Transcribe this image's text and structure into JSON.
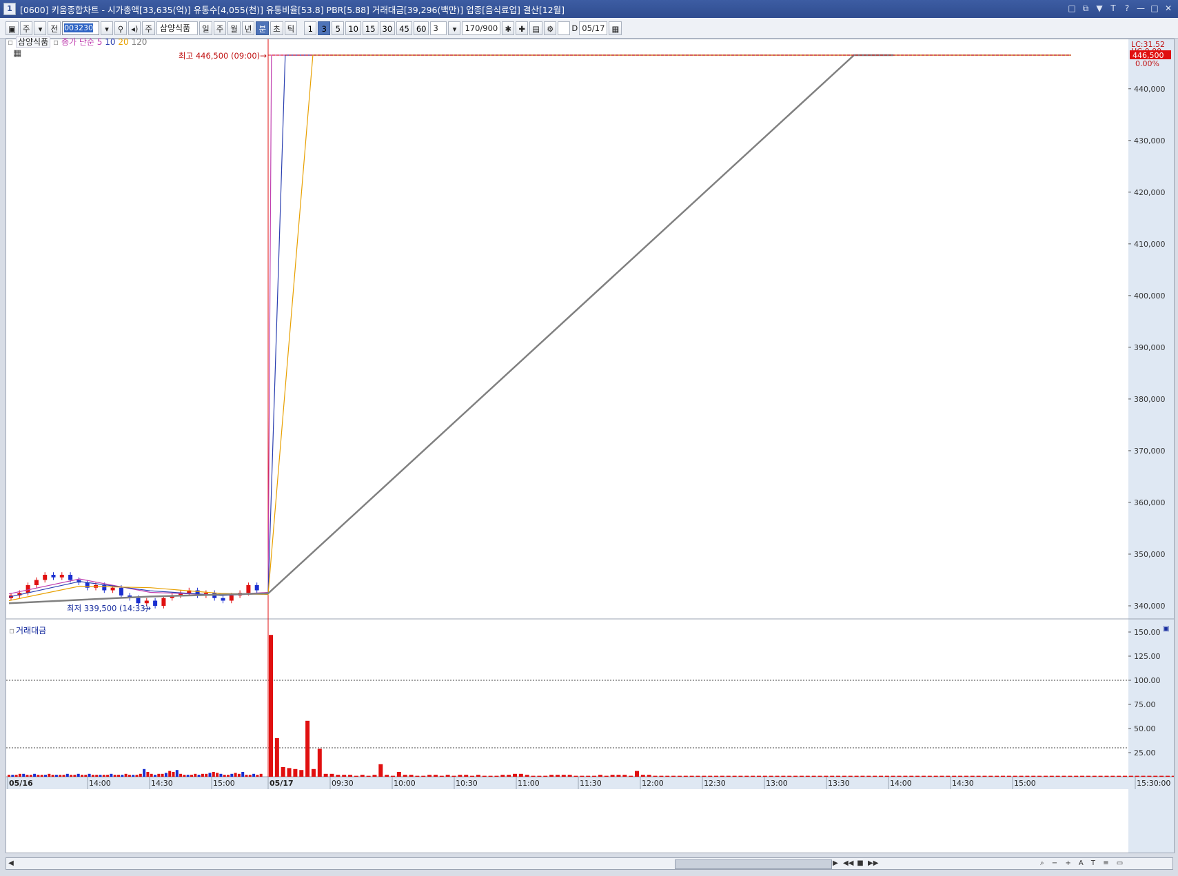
{
  "window": {
    "number": "1",
    "title": "[0600] 키움종합차트 - 시가총액[33,635(억)] 유통수[4,055(천)] 유통비율[53.8] PBR[5.88] 거래대금[39,296(백만)] 업종[음식료업] 결산[12월]",
    "buttons": [
      "□",
      "⧉",
      "▼",
      "T",
      "?",
      "—",
      "□",
      "✕"
    ]
  },
  "toolbar": {
    "market": "주",
    "all": "전",
    "code": "003230",
    "stock_name": "삼양식품",
    "periods": [
      "일",
      "주",
      "월",
      "년",
      "분",
      "초",
      "틱"
    ],
    "period_selected": "분",
    "intervals": [
      "1",
      "3",
      "5",
      "10",
      "15",
      "30",
      "45",
      "60"
    ],
    "interval_selected": "3",
    "interval_value": "3",
    "count": "170",
    "count_max": "/900",
    "date_label": "D",
    "date": "05/17"
  },
  "legend": {
    "name": "삼양식품",
    "ma_label": "종가 단순",
    "ma5": "5",
    "ma10": "10",
    "ma20": "20",
    "ma120": "120",
    "colors": {
      "ma5": "#c040b0",
      "ma10": "#2a3fb0",
      "ma20": "#e8a000",
      "ma120": "#808080"
    }
  },
  "chart_data": [
    {
      "type": "candlestick",
      "title": "삼양식품",
      "y_ticks": [
        "340,000",
        "350,000",
        "360,000",
        "370,000",
        "380,000",
        "390,000",
        "400,000",
        "410,000",
        "420,000",
        "430,000",
        "440,000"
      ],
      "ylim": [
        338000,
        448500
      ],
      "x_ticks": [
        "05/16",
        "14:00",
        "14:30",
        "15:00",
        "05/17",
        "09:30",
        "10:00",
        "10:30",
        "11:00",
        "11:30",
        "12:00",
        "12:30",
        "13:00",
        "13:30",
        "14:00",
        "14:30",
        "15:00",
        "15:30:00"
      ],
      "annotations": {
        "high": "최고 446,500 (09:00)",
        "low": "최저 339,500 (14:33)",
        "last_price": "446,500",
        "change": "0.00%",
        "lc": "LC:31.52",
        "hc": "HC:0.00"
      },
      "last_price_value": 446500,
      "prior_day_close": [
        342000,
        342500,
        344000,
        345000,
        346000,
        345500,
        346000,
        345000,
        344500,
        343500,
        344000,
        343000,
        343500,
        342000,
        341500,
        340500,
        341000,
        340000,
        341500,
        342000,
        342500,
        343000,
        342000,
        342500,
        341500,
        341000,
        342000,
        342500,
        344000,
        343000
      ],
      "ma_series": [
        {
          "name": "5",
          "points": [
            [
              0,
              342300
            ],
            [
              30,
              345200
            ],
            [
              60,
              342600
            ],
            [
              90,
              342100
            ],
            [
              110,
              342600
            ],
            [
              115,
              446500
            ],
            [
              1330,
              446500
            ]
          ]
        },
        {
          "name": "10",
          "points": [
            [
              0,
              341700
            ],
            [
              30,
              344700
            ],
            [
              60,
              342900
            ],
            [
              90,
              342000
            ],
            [
              110,
              342400
            ],
            [
              136,
              446500
            ],
            [
              1330,
              446500
            ]
          ]
        },
        {
          "name": "20",
          "points": [
            [
              0,
              341000
            ],
            [
              30,
              343800
            ],
            [
              60,
              343500
            ],
            [
              90,
              342400
            ],
            [
              110,
              342200
            ],
            [
              178,
              446500
            ],
            [
              1330,
              446500
            ]
          ]
        },
        {
          "name": "120",
          "points": [
            [
              0,
              340500
            ],
            [
              60,
              341800
            ],
            [
              110,
              342400
            ],
            [
              1000,
              446500
            ],
            [
              1060,
              446500
            ]
          ]
        }
      ]
    },
    {
      "type": "bar",
      "title": "거래대금",
      "y_ticks": [
        "25.00",
        "50.00",
        "75.00",
        "100.00",
        "125.00",
        "150.00"
      ],
      "ylim": [
        0,
        150
      ],
      "reference_lines": [
        100,
        30
      ],
      "values_prev_day": [
        2,
        2,
        2,
        3,
        3,
        2,
        2,
        3,
        2,
        2,
        2,
        3,
        2,
        2,
        2,
        2,
        3,
        2,
        2,
        3,
        2,
        2,
        3,
        2,
        2,
        2,
        2,
        2,
        3,
        2,
        2,
        2,
        3,
        2,
        2,
        2,
        3,
        8,
        5,
        3,
        2,
        3,
        3,
        4,
        6,
        5,
        7,
        3,
        2,
        2,
        2,
        3,
        2,
        3,
        3,
        4,
        5,
        4,
        3,
        2,
        2,
        3,
        4,
        3,
        5,
        2,
        2,
        3,
        2,
        3
      ],
      "values_today": [
        147,
        40,
        10,
        9,
        8,
        7,
        58,
        8,
        29,
        3,
        3,
        2,
        2,
        2,
        1,
        2,
        1,
        2,
        13,
        2,
        1,
        5,
        2,
        2,
        1,
        1,
        2,
        2,
        1,
        2,
        1,
        2,
        2,
        1,
        2,
        1,
        1,
        1,
        2,
        2,
        3,
        3,
        2,
        1,
        1,
        1,
        2,
        2,
        2,
        2,
        1,
        1,
        1,
        1,
        2,
        1,
        2,
        2,
        2,
        1,
        6,
        2,
        2,
        1,
        1,
        1,
        1,
        1,
        1,
        1,
        1,
        1,
        1,
        1,
        1,
        1,
        1,
        1,
        1,
        1,
        1,
        1,
        1,
        1,
        1,
        1,
        1,
        1,
        1,
        1,
        1,
        1,
        1,
        1,
        1,
        1,
        1,
        1,
        1,
        1,
        1,
        1,
        1,
        1,
        1,
        1,
        1,
        1,
        1,
        1,
        1,
        1,
        1,
        1,
        1,
        1,
        1,
        1,
        1,
        1,
        1,
        1,
        1,
        1,
        1,
        1,
        1,
        1,
        1,
        1,
        1,
        1,
        1,
        1,
        1,
        1,
        1,
        1,
        1,
        1,
        1,
        1,
        1,
        1,
        1,
        1,
        1,
        1,
        1,
        1,
        1,
        1,
        1,
        1,
        1,
        1,
        1,
        1,
        1,
        1,
        1,
        1,
        6,
        1,
        2,
        1,
        1,
        3,
        1,
        2
      ],
      "colors": {
        "up": "#e01010",
        "down": "#1a2fd0"
      }
    }
  ]
}
